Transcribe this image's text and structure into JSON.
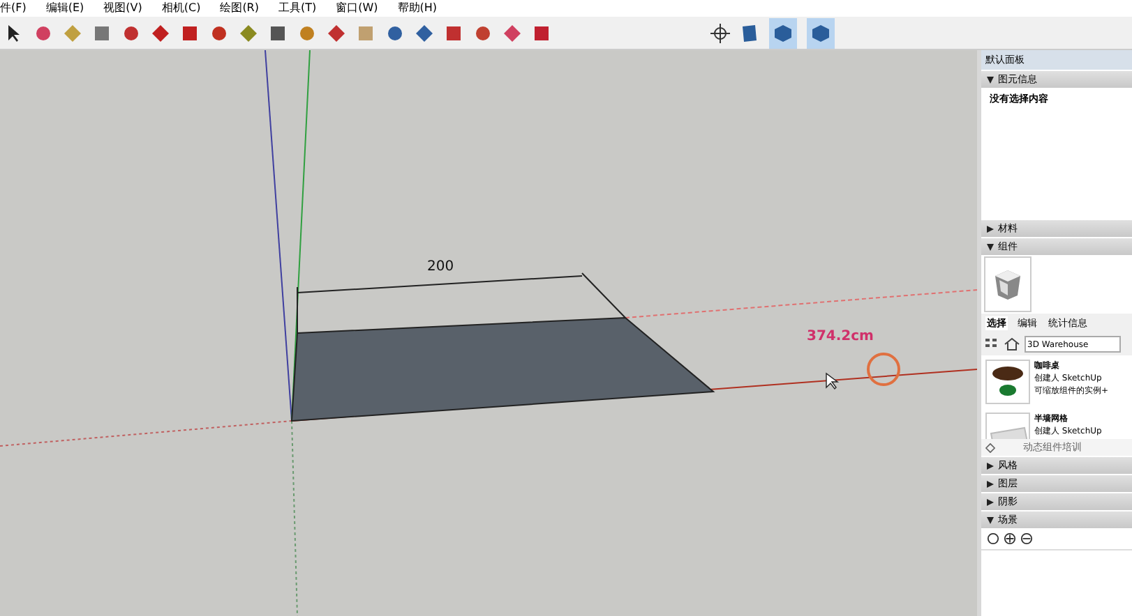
{
  "menu": [
    "件(F)",
    "编辑(E)",
    "视图(V)",
    "相机(C)",
    "绘图(R)",
    "工具(T)",
    "窗口(W)",
    "帮助(H)"
  ],
  "canvas": {
    "dimension_label": "200",
    "measure_label": "374.2cm"
  },
  "panel": {
    "title": "默认面板",
    "sections": [
      {
        "kind": "info",
        "label": "图元信息",
        "expanded": true,
        "text": "没有选择内容"
      },
      {
        "label": "材料",
        "expanded": false
      },
      {
        "kind": "components",
        "label": "组件",
        "expanded": true
      },
      {
        "label": "风格",
        "expanded": false
      },
      {
        "label": "图层",
        "expanded": false
      },
      {
        "label": "阴影",
        "expanded": false
      },
      {
        "kind": "scenes",
        "label": "场景",
        "expanded": true
      }
    ],
    "component_tabs": [
      {
        "label": "选择",
        "selected": true
      },
      {
        "label": "编辑",
        "selected": false
      },
      {
        "label": "统计信息",
        "selected": false
      }
    ],
    "search": {
      "value": "3D Warehouse"
    },
    "components": [
      {
        "kind": "table",
        "title": "咖啡桌",
        "lines": [
          "创建人 SketchUp",
          "可缩放组件的实例+"
        ]
      },
      {
        "kind": "grid",
        "title": "半墙网格",
        "lines": [
          "创建人 SketchUp"
        ]
      }
    ],
    "footer": "动态组件培训"
  }
}
